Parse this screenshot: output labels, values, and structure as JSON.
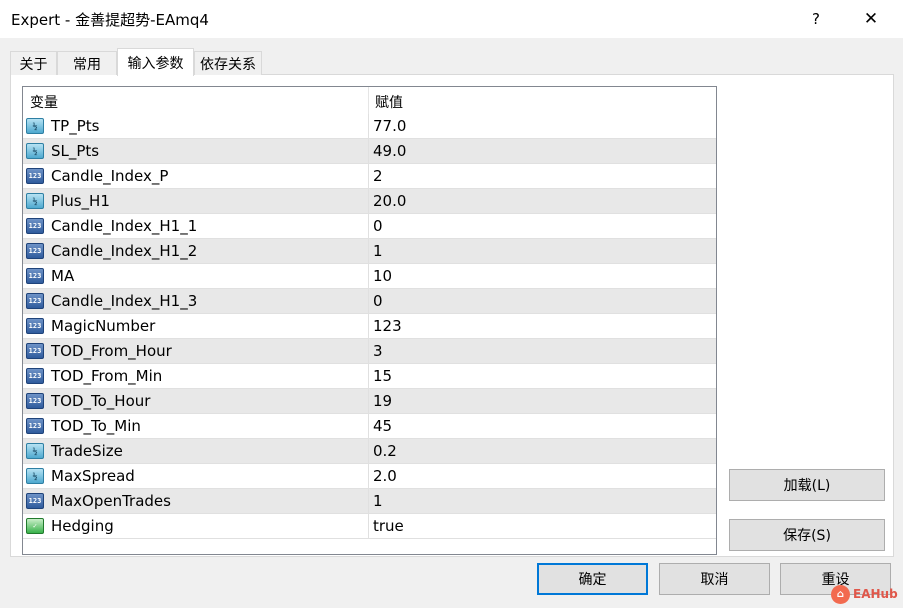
{
  "window": {
    "title": "Expert - 金善提超势-EAmq4",
    "help_label": "?",
    "close_label": "✕"
  },
  "tabs": [
    {
      "label": "关于"
    },
    {
      "label": "常用"
    },
    {
      "label": "输入参数"
    },
    {
      "label": "依存关系"
    }
  ],
  "active_tab": "输入参数",
  "grid": {
    "headers": {
      "variable": "变量",
      "value": "赋值"
    },
    "rows": [
      {
        "icon": "double-type-icon",
        "name": "TP_Pts",
        "value": "77.0"
      },
      {
        "icon": "double-type-icon",
        "name": "SL_Pts",
        "value": "49.0"
      },
      {
        "icon": "integer-type-icon",
        "name": "Candle_Index_P",
        "value": "2"
      },
      {
        "icon": "double-type-icon",
        "name": "Plus_H1",
        "value": "20.0"
      },
      {
        "icon": "integer-type-icon",
        "name": "Candle_Index_H1_1",
        "value": "0"
      },
      {
        "icon": "integer-type-icon",
        "name": "Candle_Index_H1_2",
        "value": "1"
      },
      {
        "icon": "integer-type-icon",
        "name": "MA",
        "value": "10"
      },
      {
        "icon": "integer-type-icon",
        "name": "Candle_Index_H1_3",
        "value": "0"
      },
      {
        "icon": "integer-type-icon",
        "name": "MagicNumber",
        "value": "123"
      },
      {
        "icon": "integer-type-icon",
        "name": "TOD_From_Hour",
        "value": "3"
      },
      {
        "icon": "integer-type-icon",
        "name": "TOD_From_Min",
        "value": "15"
      },
      {
        "icon": "integer-type-icon",
        "name": "TOD_To_Hour",
        "value": "19"
      },
      {
        "icon": "integer-type-icon",
        "name": "TOD_To_Min",
        "value": "45"
      },
      {
        "icon": "double-type-icon",
        "name": "TradeSize",
        "value": "0.2"
      },
      {
        "icon": "double-type-icon",
        "name": "MaxSpread",
        "value": "2.0"
      },
      {
        "icon": "integer-type-icon",
        "name": "MaxOpenTrades",
        "value": "1"
      },
      {
        "icon": "bool-type-icon",
        "name": "Hedging",
        "value": "true"
      }
    ]
  },
  "buttons": {
    "load": "加载(L)",
    "save": "保存(S)",
    "ok": "确定",
    "cancel": "取消",
    "reset": "重设"
  },
  "watermark": {
    "text": "EAHub"
  }
}
